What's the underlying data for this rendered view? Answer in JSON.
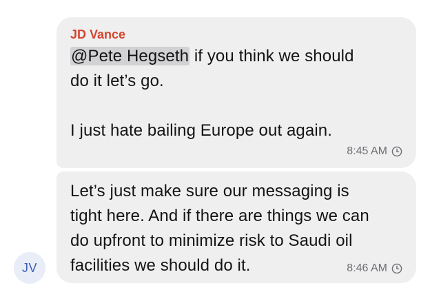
{
  "messages": [
    {
      "sender": "JD Vance",
      "mention": "@Pete Hegseth",
      "line1_rest": " if you think we should",
      "line2": "do it let’s go.",
      "line3": "I just hate bailing Europe out again.",
      "time": "8:45 AM",
      "status_icon": "clock-icon"
    },
    {
      "lines": [
        "Let’s just make sure our messaging is",
        "tight here. And if there are things we can",
        "do upfront to minimize risk to Saudi oil",
        "facilities we should do it."
      ],
      "time": "8:46 AM",
      "status_icon": "clock-icon"
    }
  ],
  "avatar": {
    "initials": "JV",
    "bg_color": "#e9edf8",
    "text_color": "#3c5fb4"
  },
  "colors": {
    "sender_name": "#d4452f",
    "bubble": "#efeff0",
    "mention_highlight": "#d2d2d5"
  }
}
